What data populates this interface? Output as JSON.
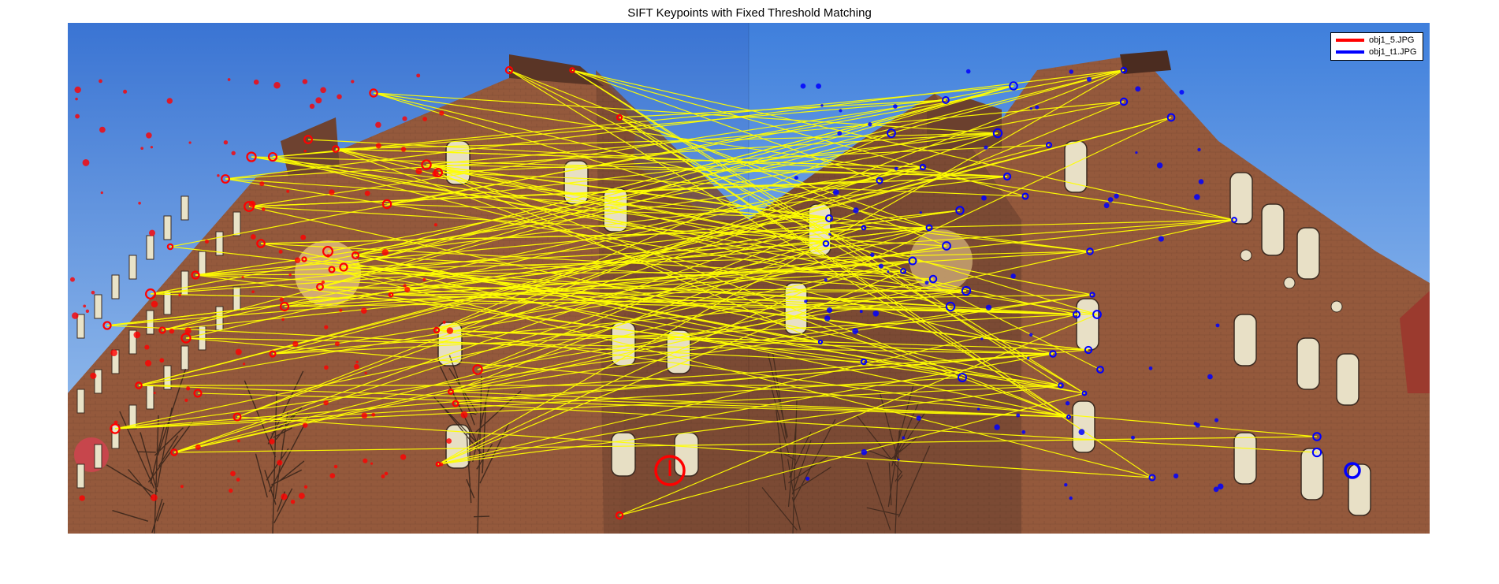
{
  "title": "SIFT Keypoints with Fixed Threshold Matching",
  "legend": {
    "items": [
      {
        "label": "obj1_5.JPG",
        "color": "#ff0000"
      },
      {
        "label": "obj1_t1.JPG",
        "color": "#0000ff"
      }
    ]
  },
  "images": {
    "left": {
      "label": "obj1_5.JPG",
      "keypoint_color": "#ff0000"
    },
    "right": {
      "label": "obj1_t1.JPG",
      "keypoint_color": "#0000ff"
    }
  },
  "match_line_color": "#ffff00",
  "sky_colors": [
    "#3f79d6",
    "#9ec3ee"
  ],
  "brick_color": "#7a4a33"
}
